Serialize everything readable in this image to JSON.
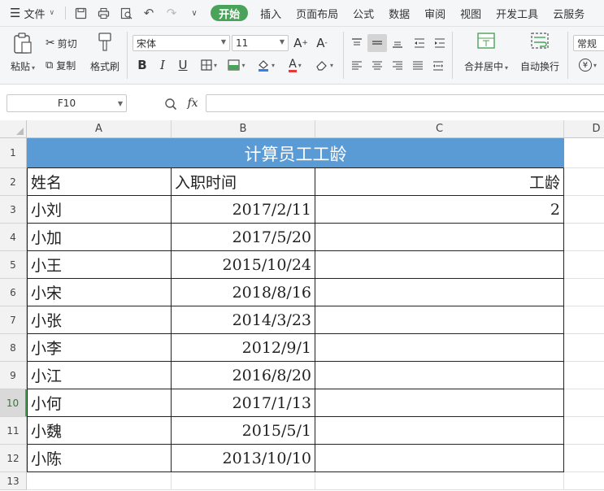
{
  "menu": {
    "file_label": "文件",
    "tabs": [
      "开始",
      "插入",
      "页面布局",
      "公式",
      "数据",
      "审阅",
      "视图",
      "开发工具",
      "云服务"
    ]
  },
  "ribbon": {
    "paste": "粘贴",
    "cut": "剪切",
    "copy": "复制",
    "format_painter": "格式刷",
    "font_name": "宋体",
    "font_size": "11",
    "merge_center": "合并居中",
    "wrap_text": "自动换行",
    "number_format": "常规"
  },
  "formula_bar": {
    "cell_ref": "F10",
    "fx": "fx",
    "content": ""
  },
  "sheet": {
    "columns": [
      "A",
      "B",
      "C",
      "D"
    ],
    "rows": [
      "1",
      "2",
      "3",
      "4",
      "5",
      "6",
      "7",
      "8",
      "9",
      "10",
      "11",
      "12",
      "13"
    ],
    "selected_row": "10",
    "title": "计算员工工龄",
    "headers": {
      "name": "姓名",
      "date": "入职时间",
      "years": "工龄"
    },
    "records": [
      {
        "name": "小刘",
        "date": "2017/2/11",
        "years": "2"
      },
      {
        "name": "小加",
        "date": "2017/5/20",
        "years": ""
      },
      {
        "name": "小王",
        "date": "2015/10/24",
        "years": ""
      },
      {
        "name": "小宋",
        "date": "2018/8/16",
        "years": ""
      },
      {
        "name": "小张",
        "date": "2014/3/23",
        "years": ""
      },
      {
        "name": "小李",
        "date": "2012/9/1",
        "years": ""
      },
      {
        "name": "小江",
        "date": "2016/8/20",
        "years": ""
      },
      {
        "name": "小何",
        "date": "2017/1/13",
        "years": ""
      },
      {
        "name": "小魏",
        "date": "2015/5/1",
        "years": ""
      },
      {
        "name": "小陈",
        "date": "2013/10/10",
        "years": ""
      }
    ]
  },
  "colors": {
    "title_bg": "#5b9bd5",
    "active_tab": "#4aa35a"
  }
}
